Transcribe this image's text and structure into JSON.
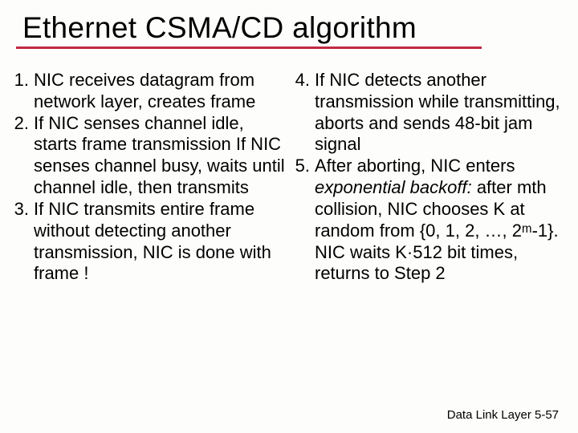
{
  "title": "Ethernet CSMA/CD algorithm",
  "left": {
    "items": [
      {
        "num": "1.",
        "text": "NIC receives datagram from network layer, creates frame"
      },
      {
        "num": "2.",
        "text": "If NIC senses channel idle, starts frame transmission If NIC senses channel busy, waits until channel idle, then transmits"
      },
      {
        "num": "3.",
        "text": "If NIC transmits entire frame without detecting another transmission, NIC is done with frame !"
      }
    ]
  },
  "right": {
    "items": [
      {
        "num": "4.",
        "text": "If NIC detects another transmission while transmitting,  aborts and sends 48-bit jam signal"
      },
      {
        "num": "5.",
        "pre": "After aborting, NIC enters ",
        "ital": "exponential backoff:",
        "post": " after mth collision, NIC chooses K at random from {0, 1, 2, …, 2ᵐ-1}. NIC waits K·512 bit times, returns to Step 2"
      }
    ]
  },
  "footer": "Data Link Layer  5-57"
}
